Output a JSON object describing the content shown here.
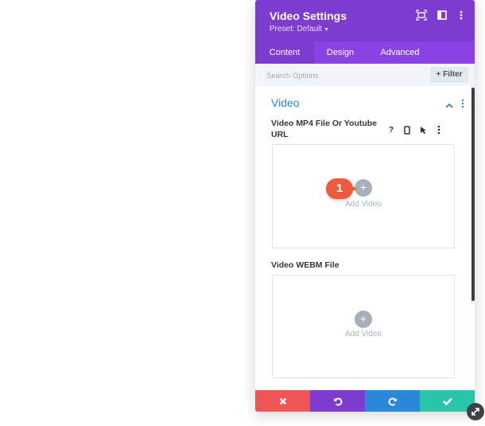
{
  "panel": {
    "title": "Video Settings",
    "preset": "Preset: Default",
    "header_icons": [
      "expand-icon",
      "split-view-icon",
      "more-vertical-icon"
    ]
  },
  "tabs": [
    {
      "label": "Content",
      "active": true
    },
    {
      "label": "Design",
      "active": false
    },
    {
      "label": "Advanced",
      "active": false
    }
  ],
  "filterbar": {
    "search_placeholder": "Search Options",
    "filter_label": "+ Filter"
  },
  "section": {
    "title": "Video"
  },
  "fields": [
    {
      "label": "Video MP4 File Or Youtube URL",
      "add_label": "Add Video"
    },
    {
      "label": "Video WEBM File",
      "add_label": "Add Video"
    }
  ],
  "field_icons": [
    "help-icon",
    "mobile-icon",
    "pointer-icon",
    "more-vertical-icon"
  ],
  "badge": {
    "number": "1"
  },
  "footer": {
    "buttons": [
      "close-icon",
      "undo-icon",
      "redo-icon",
      "check-icon"
    ],
    "colors": [
      "#ef5555",
      "#7e3bd0",
      "#2b87da",
      "#29c4a9"
    ]
  },
  "colors": {
    "header": "#7e3bd0",
    "tabs": "#8c41e5",
    "accent": "#2b87da",
    "badge": "#ee5a3f"
  }
}
